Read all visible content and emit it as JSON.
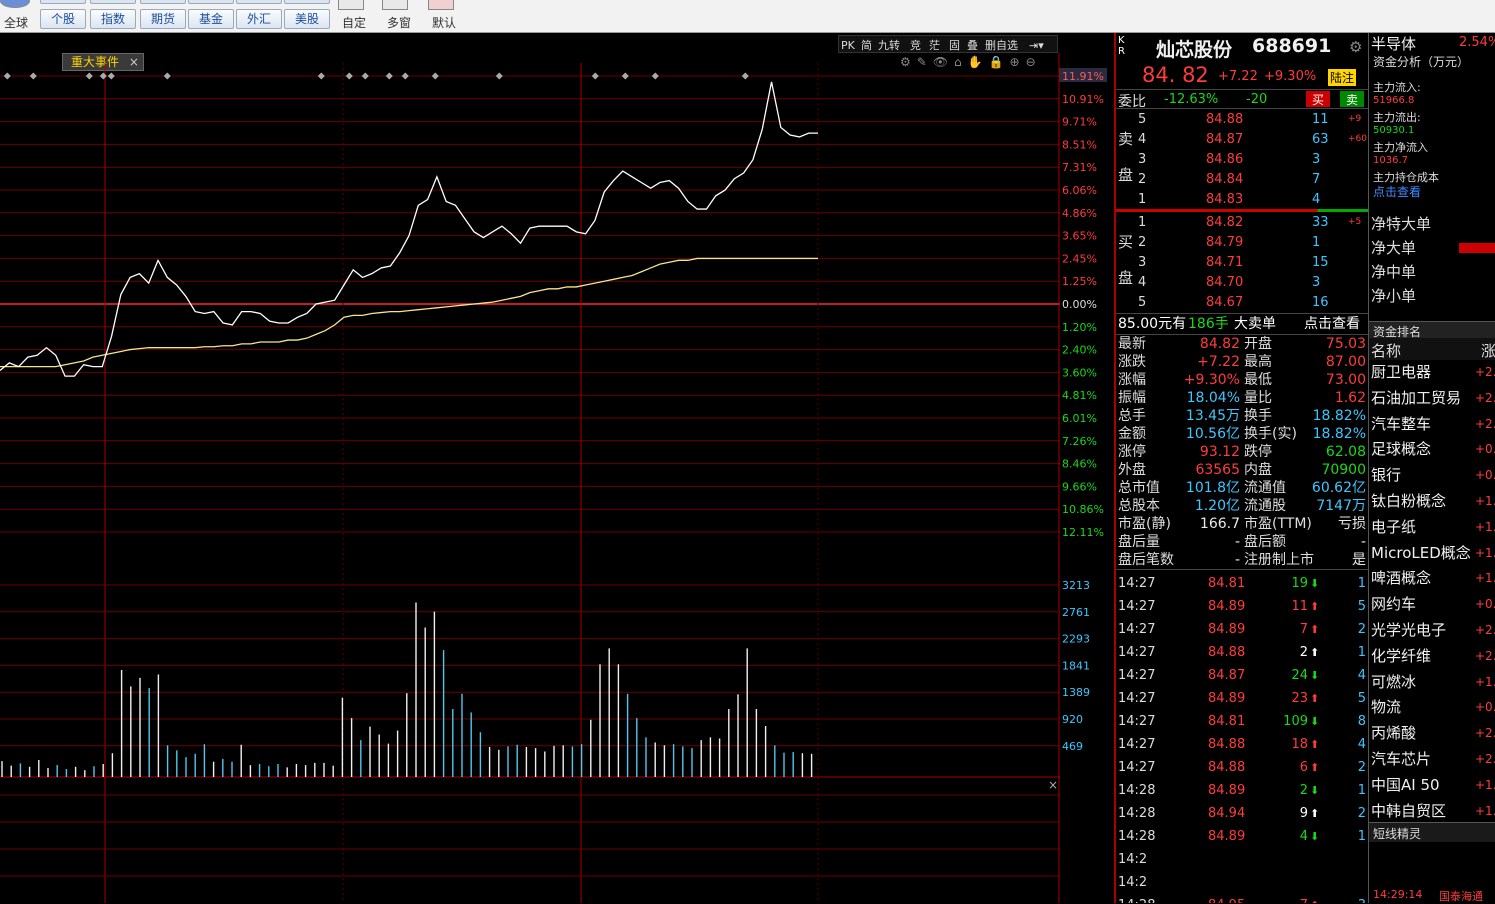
{
  "toolbar": {
    "row1": [
      "全球",
      "个股",
      "指数",
      "期货",
      "基金",
      "外汇",
      "美股"
    ],
    "row2": [
      "自定",
      "多窗",
      "默认"
    ]
  },
  "chart_tabs": {
    "tags": [
      "PK",
      "简",
      "九转",
      "竞",
      "茫",
      "固",
      "叠",
      "删自选"
    ],
    "event_tab": "重大事件"
  },
  "pct_axis": [
    "11.91%",
    "10.91%",
    "9.71%",
    "8.51%",
    "7.31%",
    "6.06%",
    "4.86%",
    "3.65%",
    "2.45%",
    "1.25%",
    "0.00%",
    "1.20%",
    "2.40%",
    "3.60%",
    "4.81%",
    "6.01%",
    "7.26%",
    "8.46%",
    "9.66%",
    "10.86%",
    "12.11%"
  ],
  "vol_axis": [
    "3213",
    "2761",
    "2293",
    "1841",
    "1389",
    "920",
    "469"
  ],
  "stock": {
    "kr": "K\nR",
    "name": "灿芯股份",
    "code": "688691",
    "price": "84. 82",
    "change": "+7.22",
    "change_pct": "+9.30%",
    "badge": "陆注",
    "weibi_label": "委比",
    "weibi": "-12.63%",
    "weicha": "-20",
    "buy_btn": "买",
    "sell_btn": "卖"
  },
  "asks": [
    {
      "lvl": "5",
      "price": "84.88",
      "vol": "11",
      "chg": "+9"
    },
    {
      "lvl": "4",
      "price": "84.87",
      "vol": "63",
      "chg": "+60"
    },
    {
      "lvl": "3",
      "price": "84.86",
      "vol": "3",
      "chg": ""
    },
    {
      "lvl": "2",
      "price": "84.84",
      "vol": "7",
      "chg": ""
    },
    {
      "lvl": "1",
      "price": "84.83",
      "vol": "4",
      "chg": ""
    }
  ],
  "bids": [
    {
      "lvl": "1",
      "price": "84.82",
      "vol": "33",
      "chg": "+5"
    },
    {
      "lvl": "2",
      "price": "84.79",
      "vol": "1",
      "chg": ""
    },
    {
      "lvl": "3",
      "price": "84.71",
      "vol": "15",
      "chg": ""
    },
    {
      "lvl": "4",
      "price": "84.70",
      "vol": "3",
      "chg": ""
    },
    {
      "lvl": "5",
      "price": "84.67",
      "vol": "16",
      "chg": ""
    }
  ],
  "ask_side_label": [
    "卖",
    "盘"
  ],
  "bid_side_label": [
    "买",
    "盘"
  ],
  "big_order": {
    "price": "85.00元有",
    "vol": "186手",
    "label": "大卖单",
    "link": "点击查看"
  },
  "stats": [
    {
      "l1": "最新",
      "v1": "84.82",
      "c1": "red",
      "l2": "开盘",
      "v2": "75.03",
      "c2": "red"
    },
    {
      "l1": "涨跌",
      "v1": "+7.22",
      "c1": "red",
      "l2": "最高",
      "v2": "87.00",
      "c2": "red"
    },
    {
      "l1": "涨幅",
      "v1": "+9.30%",
      "c1": "red",
      "l2": "最低",
      "v2": "73.00",
      "c2": "red"
    },
    {
      "l1": "振幅",
      "v1": "18.04%",
      "c1": "cyan",
      "l2": "量比",
      "v2": "1.62",
      "c2": "red"
    },
    {
      "l1": "总手",
      "v1": "13.45万",
      "c1": "cyan",
      "l2": "换手",
      "v2": "18.82%",
      "c2": "cyan"
    },
    {
      "l1": "金额",
      "v1": "10.56亿",
      "c1": "cyan",
      "l2": "换手(实)",
      "v2": "18.82%",
      "c2": "cyan"
    },
    {
      "l1": "涨停",
      "v1": "93.12",
      "c1": "red",
      "l2": "跌停",
      "v2": "62.08",
      "c2": "green"
    },
    {
      "l1": "外盘",
      "v1": "63565",
      "c1": "red",
      "l2": "内盘",
      "v2": "70900",
      "c2": "green"
    },
    {
      "l1": "总市值",
      "v1": "101.8亿",
      "c1": "cyan",
      "l2": "流通值",
      "v2": "60.62亿",
      "c2": "cyan"
    },
    {
      "l1": "总股本",
      "v1": "1.20亿",
      "c1": "cyan",
      "l2": "流通股",
      "v2": "7147万",
      "c2": "cyan"
    },
    {
      "l1": "市盈(静)",
      "v1": "166.7",
      "c1": "white",
      "l2": "市盈(TTM)",
      "v2": "亏损",
      "c2": "white"
    },
    {
      "l1": "盘后量",
      "v1": "-",
      "c1": "white",
      "l2": "盘后额",
      "v2": "-",
      "c2": "white"
    },
    {
      "l1": "盘后笔数",
      "v1": "-",
      "c1": "white",
      "l2": "注册制上市",
      "v2": "是",
      "c2": "white"
    }
  ],
  "ticks": [
    {
      "t": "14:27",
      "p": "84.81",
      "v": "19",
      "dir": "down",
      "n": "1"
    },
    {
      "t": "14:27",
      "p": "84.89",
      "v": "11",
      "dir": "up",
      "n": "5"
    },
    {
      "t": "14:27",
      "p": "84.89",
      "v": "7",
      "dir": "up",
      "n": "2"
    },
    {
      "t": "14:27",
      "p": "84.88",
      "v": "2",
      "dir": "upw",
      "n": "1"
    },
    {
      "t": "14:27",
      "p": "84.87",
      "v": "24",
      "dir": "down",
      "n": "4"
    },
    {
      "t": "14:27",
      "p": "84.89",
      "v": "23",
      "dir": "up",
      "n": "5"
    },
    {
      "t": "14:27",
      "p": "84.81",
      "v": "109",
      "dir": "down",
      "n": "8"
    },
    {
      "t": "14:27",
      "p": "84.88",
      "v": "18",
      "dir": "up",
      "n": "4"
    },
    {
      "t": "14:27",
      "p": "84.88",
      "v": "6",
      "dir": "up",
      "n": "2"
    },
    {
      "t": "14:28",
      "p": "84.89",
      "v": "2",
      "dir": "down",
      "n": "1"
    },
    {
      "t": "14:28",
      "p": "84.94",
      "v": "9",
      "dir": "upw",
      "n": "2"
    },
    {
      "t": "14:28",
      "p": "84.89",
      "v": "4",
      "dir": "down",
      "n": "1"
    },
    {
      "t": "14:2",
      "p": "",
      "v": "",
      "dir": "",
      "n": ""
    },
    {
      "t": "14:2",
      "p": "",
      "v": "",
      "dir": "",
      "n": ""
    },
    {
      "t": "14:28",
      "p": "84.95",
      "v": "7",
      "dir": "up",
      "n": "3"
    }
  ],
  "sector": {
    "name": "半导体",
    "pct": "2.54%",
    "fund_title": "资金分析（万元）",
    "main_in_label": "主力流入:",
    "main_in": "51966.8",
    "main_out_label": "主力流出:",
    "main_out": "50930.1",
    "net_label": "主力净流入",
    "net": "1036.7",
    "cost_label": "主力持仓成本",
    "cost_link": "点击查看",
    "flows": [
      "净特大单",
      "净大单",
      "净中单",
      "净小单"
    ],
    "rank_title": "资金排名",
    "col_name": "名称",
    "col_pct": "涨",
    "items": [
      {
        "n": "厨卫电器",
        "p": "+2."
      },
      {
        "n": "石油加工贸易",
        "p": "+2."
      },
      {
        "n": "汽车整车",
        "p": "+2."
      },
      {
        "n": "足球概念",
        "p": "+0."
      },
      {
        "n": "银行",
        "p": "+0."
      },
      {
        "n": "钛白粉概念",
        "p": "+1."
      },
      {
        "n": "电子纸",
        "p": "+1."
      },
      {
        "n": "MicroLED概念",
        "p": "+1."
      },
      {
        "n": "啤酒概念",
        "p": "+1."
      },
      {
        "n": "网约车",
        "p": "+0."
      },
      {
        "n": "光学光电子",
        "p": "+2."
      },
      {
        "n": "化学纤维",
        "p": "+2."
      },
      {
        "n": "可燃冰",
        "p": "+1."
      },
      {
        "n": "物流",
        "p": "+0."
      },
      {
        "n": "丙烯酸",
        "p": "+2."
      },
      {
        "n": "汽车芯片",
        "p": "+2."
      },
      {
        "n": "中国AI 50",
        "p": "+1."
      },
      {
        "n": "中韩自贸区",
        "p": "+1."
      }
    ],
    "sprite": "短线精灵",
    "time": "14:29:14",
    "broker": "国泰海通"
  },
  "chart_data": {
    "type": "line",
    "ylim_pct": [
      -12.11,
      11.91
    ],
    "price_pct": [
      -3.6,
      -3.2,
      -3.4,
      -2.9,
      -2.8,
      -2.4,
      -2.8,
      -3.9,
      -3.9,
      -3.3,
      -3.4,
      -3.4,
      -1.8,
      0.4,
      1.3,
      1.5,
      1.0,
      2.2,
      1.3,
      0.9,
      0.3,
      -0.5,
      -0.6,
      -0.5,
      -1.1,
      -1.2,
      -0.5,
      -0.5,
      -0.6,
      -1.0,
      -1.1,
      -1.1,
      -0.8,
      -0.6,
      -0.1,
      0.0,
      0.1,
      0.9,
      1.7,
      1.3,
      1.5,
      1.8,
      1.9,
      2.6,
      3.5,
      5.1,
      5.4,
      6.6,
      5.3,
      5.1,
      4.4,
      3.7,
      3.4,
      3.7,
      4.0,
      3.6,
      3.1,
      3.9,
      4.0,
      4.0,
      4.0,
      4.0,
      3.7,
      3.6,
      4.3,
      5.8,
      6.4,
      6.9,
      6.6,
      6.3,
      6.0,
      6.3,
      6.4,
      6.0,
      5.3,
      4.9,
      4.9,
      5.6,
      5.9,
      6.5,
      6.8,
      7.5,
      9.1,
      11.6,
      9.2,
      8.8,
      8.7,
      8.9,
      8.9
    ],
    "avg_pct": [
      -3.4,
      -3.4,
      -3.4,
      -3.4,
      -3.4,
      -3.4,
      -3.4,
      -3.3,
      -3.2,
      -3.1,
      -2.9,
      -2.8,
      -2.7,
      -2.6,
      -2.5,
      -2.45,
      -2.4,
      -2.4,
      -2.4,
      -2.4,
      -2.4,
      -2.4,
      -2.35,
      -2.35,
      -2.3,
      -2.3,
      -2.2,
      -2.2,
      -2.1,
      -2.1,
      -2.1,
      -2.0,
      -2.0,
      -1.9,
      -1.7,
      -1.5,
      -1.2,
      -0.8,
      -0.7,
      -0.7,
      -0.6,
      -0.55,
      -0.5,
      -0.5,
      -0.45,
      -0.4,
      -0.35,
      -0.3,
      -0.25,
      -0.2,
      -0.15,
      -0.1,
      -0.05,
      0.0,
      0.1,
      0.2,
      0.3,
      0.5,
      0.6,
      0.7,
      0.7,
      0.8,
      0.8,
      0.9,
      1.0,
      1.1,
      1.2,
      1.3,
      1.4,
      1.6,
      1.8,
      2.0,
      2.1,
      2.2,
      2.2,
      2.3,
      2.3,
      2.3,
      2.3,
      2.3,
      2.3,
      2.3,
      2.3,
      2.3,
      2.3,
      2.3,
      2.3,
      2.3,
      2.3
    ],
    "volume": [
      280,
      200,
      240,
      180,
      300,
      160,
      210,
      140,
      180,
      120,
      190,
      230,
      420,
      1890,
      1600,
      1750,
      1570,
      1810,
      560,
      470,
      350,
      410,
      580,
      270,
      320,
      270,
      570,
      210,
      230,
      190,
      230,
      170,
      230,
      210,
      250,
      250,
      200,
      1400,
      1040,
      650,
      890,
      750,
      590,
      820,
      1480,
      3080,
      2640,
      2920,
      2240,
      1200,
      1470,
      1140,
      790,
      530,
      480,
      540,
      570,
      530,
      510,
      450,
      550,
      560,
      540,
      580,
      1010,
      1990,
      2270,
      1990,
      1470,
      1040,
      700,
      610,
      560,
      580,
      540,
      510,
      650,
      700,
      680,
      1200,
      1460,
      2270,
      1200,
      900,
      560,
      430,
      440,
      420,
      410
    ]
  }
}
